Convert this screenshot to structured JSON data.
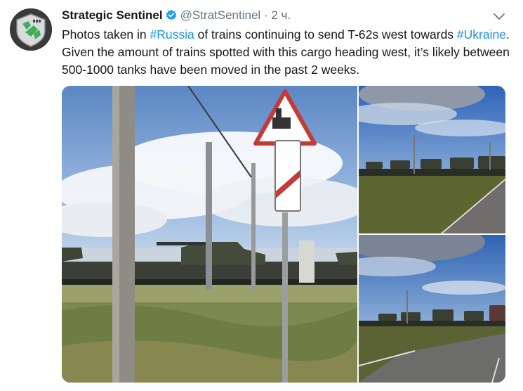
{
  "tweet": {
    "author_name": "Strategic Sentinel",
    "handle": "@StratSentinel",
    "separator": "·",
    "time": "2 ч.",
    "text_part1": "Photos taken in ",
    "hashtag1": "#Russia",
    "text_part2": " of trains continuing to send T-62s west towards ",
    "hashtag2": "#Ukraine",
    "text_part3": ". Given the amount of trains spotted with this cargo heading west, it’s likely between 500-1000 tanks have been moved in the past 2 weeks."
  },
  "icons": {
    "verified": "verified-badge-icon",
    "menu": "chevron-down-icon"
  },
  "colors": {
    "link": "#1b95e0",
    "verified": "#1da1f2",
    "muted": "#657786"
  }
}
